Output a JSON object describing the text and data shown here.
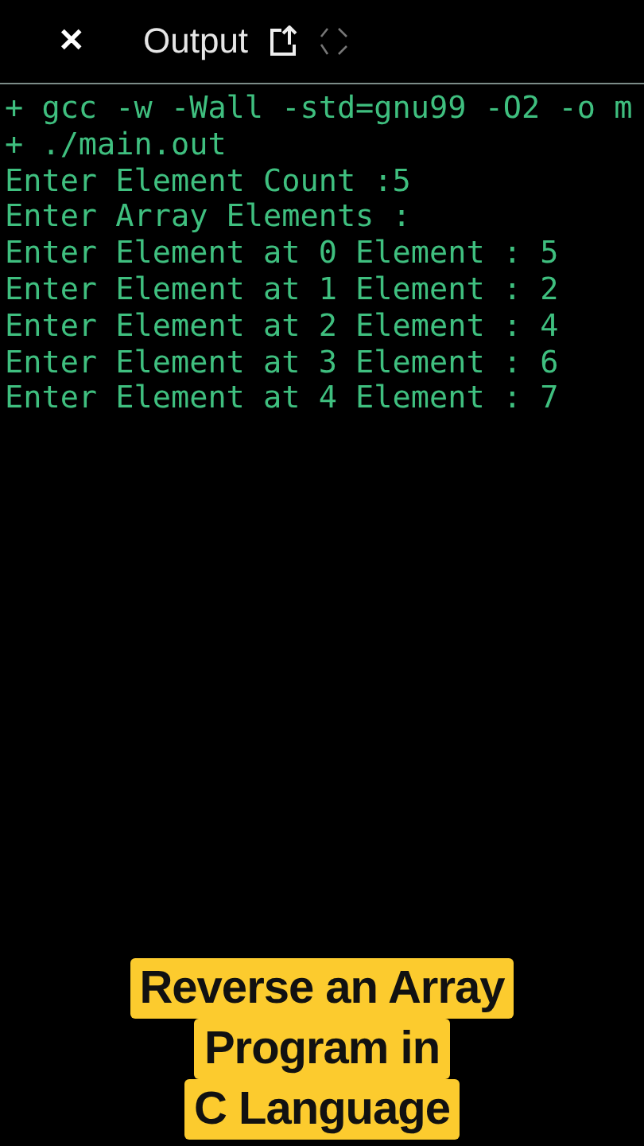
{
  "header": {
    "close": "✕",
    "title": "Output"
  },
  "console": {
    "lines": [
      "+ gcc -w -Wall -std=gnu99 -O2 -o m",
      "+ ./main.out",
      "Enter Element Count :5",
      "Enter Array Elements :",
      "Enter Element at 0 Element : 5",
      "Enter Element at 1 Element : 2",
      "Enter Element at 2 Element : 4",
      "Enter Element at 3 Element : 6",
      "Enter Element at 4 Element : 7"
    ]
  },
  "caption": {
    "lines": [
      "Reverse an Array",
      "Program in",
      "C Language"
    ]
  }
}
